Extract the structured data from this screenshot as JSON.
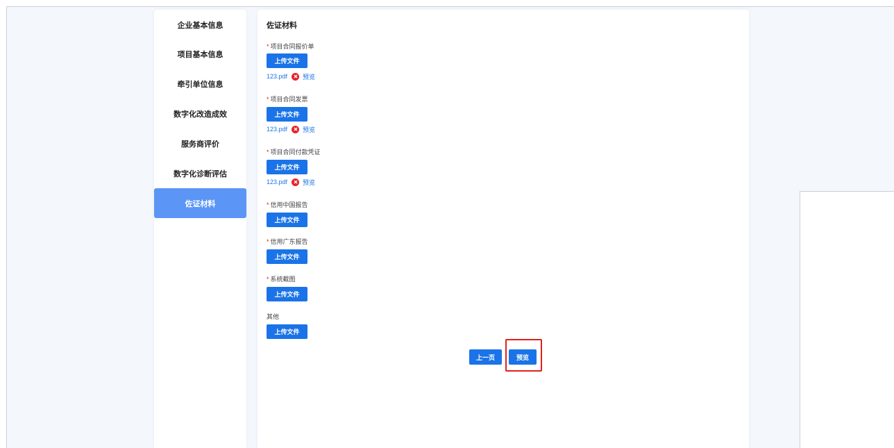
{
  "sidebar": {
    "items": [
      {
        "label": "企业基本信息"
      },
      {
        "label": "项目基本信息"
      },
      {
        "label": "牵引单位信息"
      },
      {
        "label": "数字化改造成效"
      },
      {
        "label": "服务商评价"
      },
      {
        "label": "数字化诊断评估"
      },
      {
        "label": "佐证材料"
      }
    ],
    "active_index": 6
  },
  "main": {
    "title": "佐证材料",
    "upload_label": "上传文件",
    "fields": [
      {
        "required_mark": "*",
        "label": "项目合同报价单",
        "file": {
          "name": "123.pdf",
          "preview": "预览"
        }
      },
      {
        "required_mark": "*",
        "label": "项目合同发票",
        "file": {
          "name": "123.pdf",
          "preview": "预览"
        }
      },
      {
        "required_mark": "*",
        "label": "项目合同付款凭证",
        "file": {
          "name": "123.pdf",
          "preview": "预览"
        }
      },
      {
        "required_mark": "*",
        "label": "信用中国报告"
      },
      {
        "required_mark": "*",
        "label": "信用广东报告"
      },
      {
        "required_mark": "*",
        "label": "系统截图"
      },
      {
        "required_mark": "",
        "label": "其他"
      }
    ],
    "prev_button": "上一页",
    "preview_button": "预览"
  },
  "colors": {
    "primary": "#1a73e8",
    "active_nav": "#5b95f5",
    "required": "#e02020",
    "highlight": "#e0201c",
    "background": "#f4f8fd"
  }
}
